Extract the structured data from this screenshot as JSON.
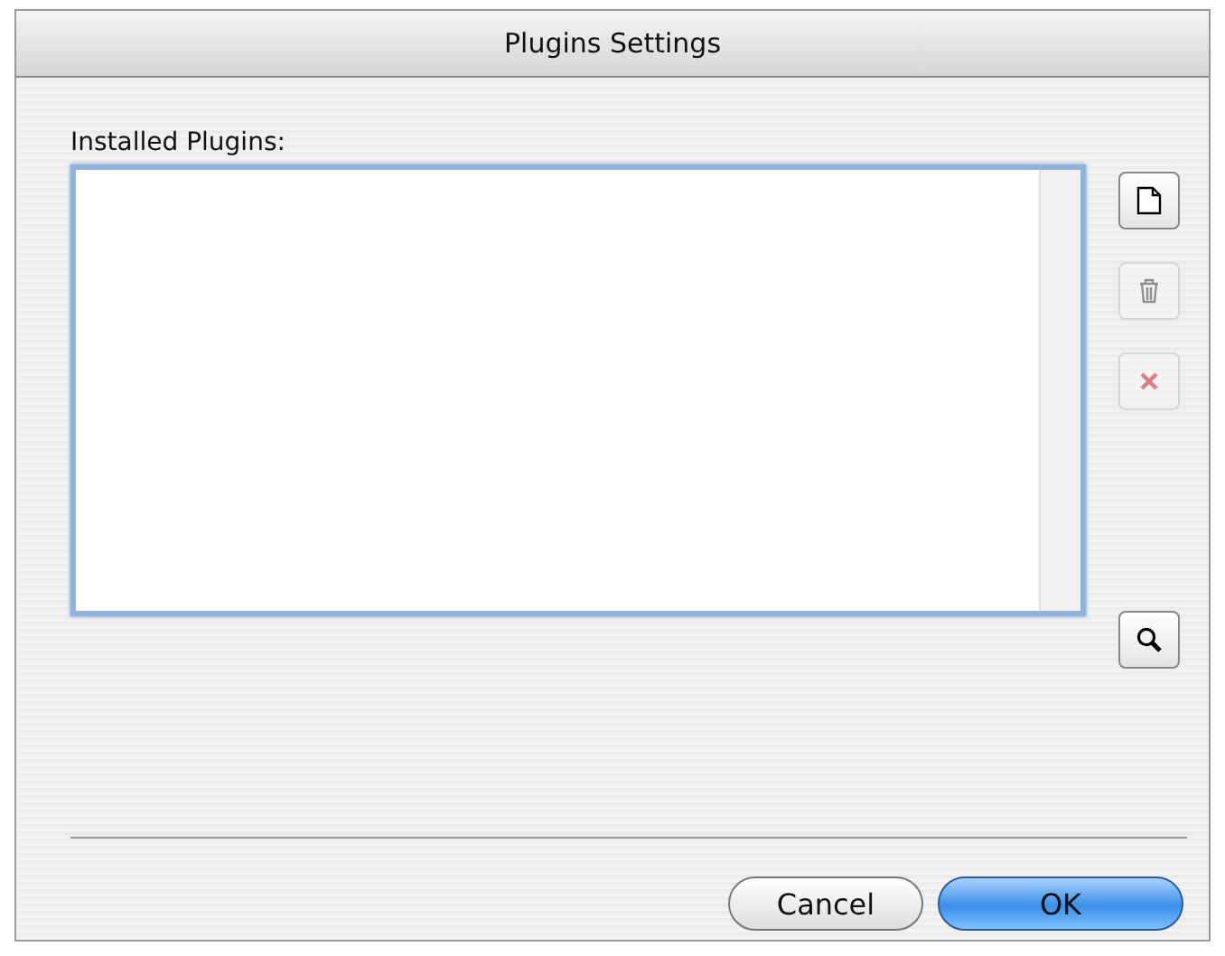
{
  "window": {
    "title": "Plugins Settings"
  },
  "plugins": {
    "label": "Installed Plugins:"
  },
  "tools": [
    {
      "kind": "new",
      "disabled": false
    },
    {
      "kind": "trash",
      "disabled": true
    },
    {
      "kind": "remove",
      "disabled": true
    },
    {
      "kind": "find",
      "disabled": false
    }
  ],
  "buttons": [
    {
      "label": "Cancel",
      "default": false
    },
    {
      "label": "OK",
      "default": true
    }
  ]
}
